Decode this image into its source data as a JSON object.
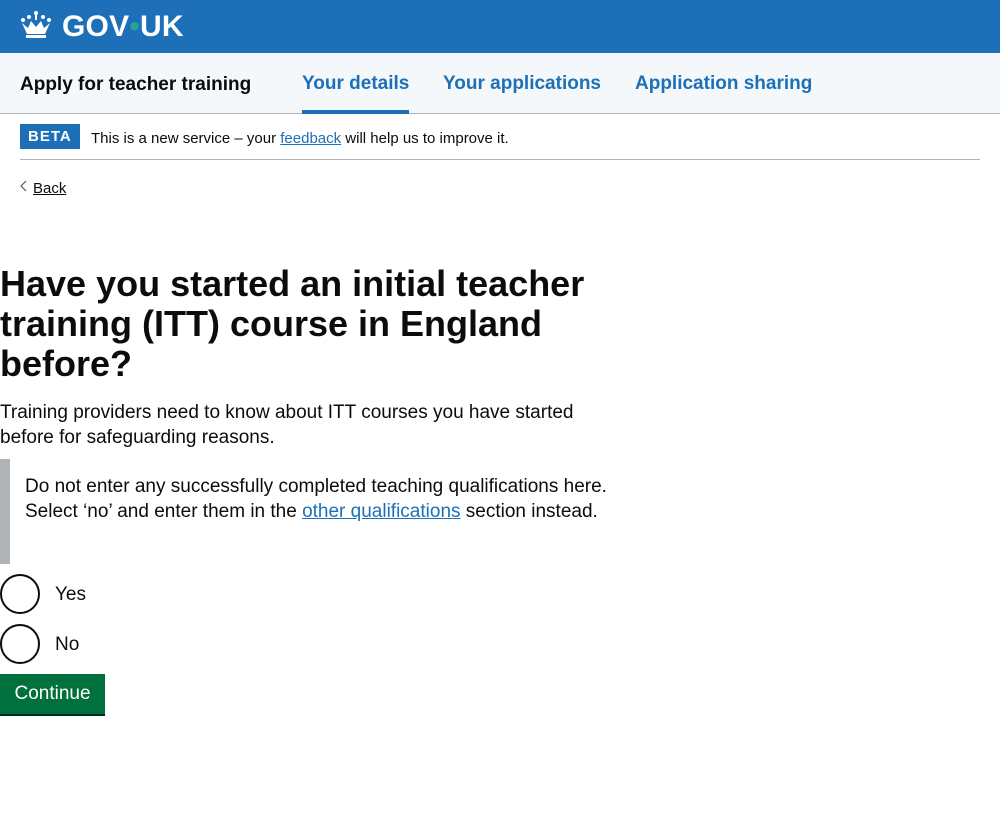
{
  "header": {
    "logo_text_left": "GOV",
    "logo_dot": "•",
    "logo_text_right": "UK",
    "brand_color": "#1d70b8"
  },
  "service_nav": {
    "service_name": "Apply for teacher training",
    "links": [
      {
        "label": "Your details",
        "active": true
      },
      {
        "label": "Your applications",
        "active": false
      },
      {
        "label": "Application sharing",
        "active": false
      }
    ]
  },
  "phase_banner": {
    "tag": "BETA",
    "text_before": "This is a new service – your ",
    "link": "feedback",
    "text_after": " will help us to improve it."
  },
  "back_link": "Back",
  "question": {
    "title": "Have you started an initial teacher training (ITT) course in England before?",
    "hint": "Training providers need to know about ITT courses you have started before for safeguarding reasons.",
    "inset_before": "Do not enter any successfully completed teaching qualifications here. Select ‘no’ and enter them in the ",
    "inset_link": "other qualifications",
    "inset_after": " section instead.",
    "options": [
      "Yes",
      "No"
    ]
  },
  "continue_label": "Continue",
  "colors": {
    "link": "#1d70b8",
    "button": "#00703c",
    "inset_border": "#b1b4b6"
  }
}
